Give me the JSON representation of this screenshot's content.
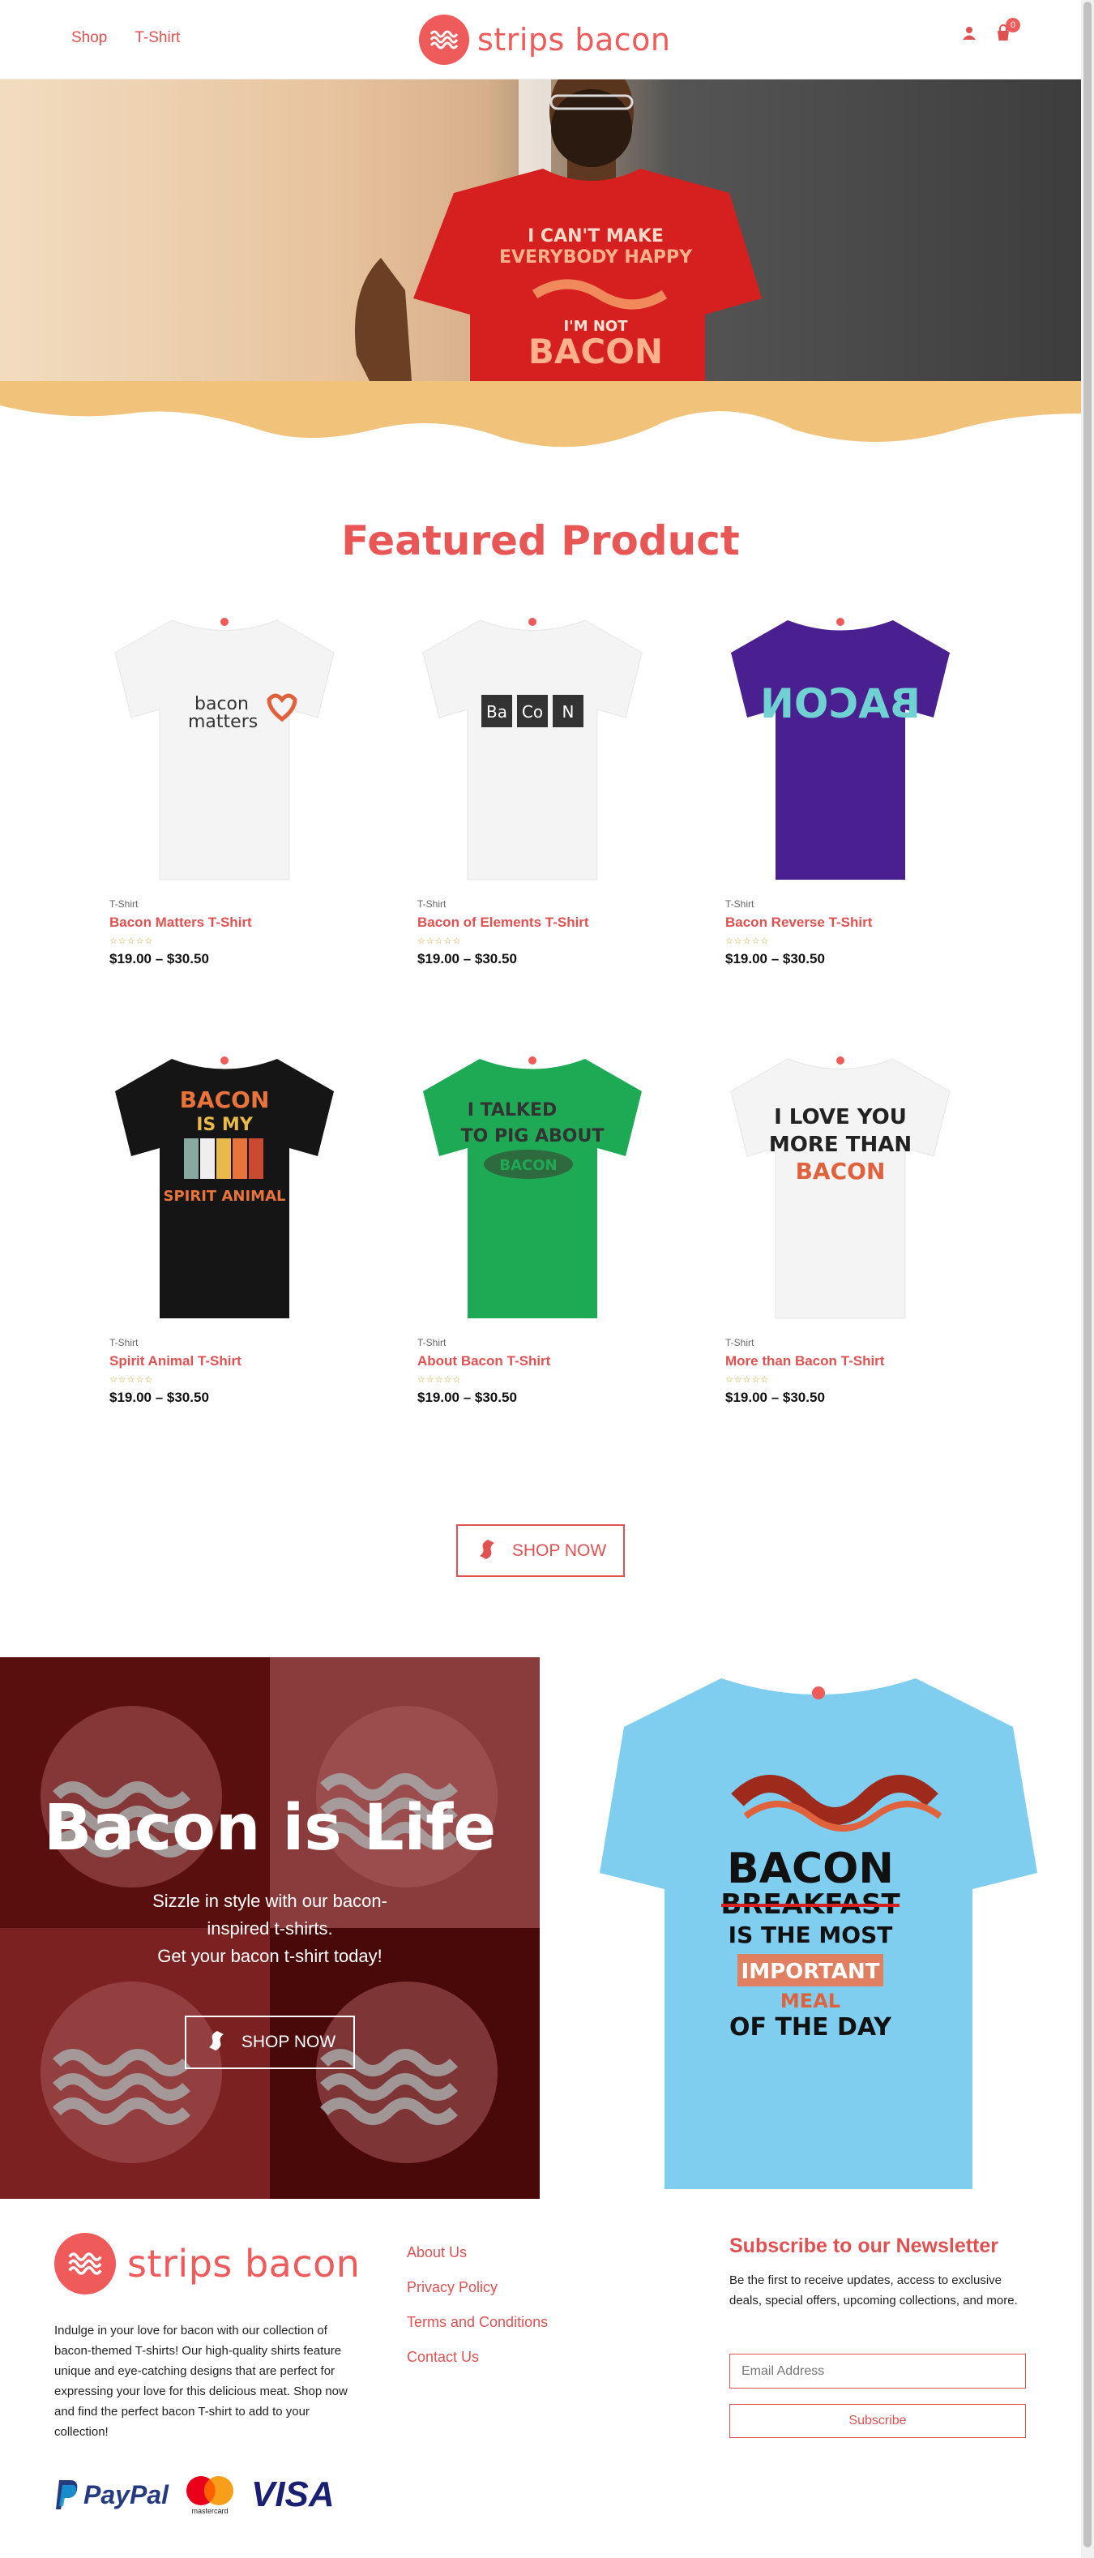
{
  "header": {
    "nav": [
      "Shop",
      "T-Shirt"
    ],
    "logo_text": "strips bacon",
    "cart_count": "0",
    "icons": [
      "user-icon",
      "cart-icon"
    ]
  },
  "hero": {
    "shirt_text": [
      "I CAN'T MAKE",
      "EVERYBODY HAPPY",
      "I'M NOT",
      "BACON"
    ]
  },
  "featured": {
    "title": "Featured Product",
    "products": [
      {
        "category": "T-Shirt",
        "name": "Bacon Matters T-Shirt",
        "price": "$19.00 – $30.50",
        "shirt_color": "#f4f4f4",
        "print": [
          "bacon",
          "matters"
        ]
      },
      {
        "category": "T-Shirt",
        "name": "Bacon of Elements T-Shirt",
        "price": "$19.00 – $30.50",
        "shirt_color": "#f4f4f4",
        "print": [
          "Ba",
          "Co",
          "N"
        ]
      },
      {
        "category": "T-Shirt",
        "name": "Bacon Reverse T-Shirt",
        "price": "$19.00 – $30.50",
        "shirt_color": "#4a1f8f",
        "print": [
          "BACON"
        ]
      },
      {
        "category": "T-Shirt",
        "name": "Spirit Animal T-Shirt",
        "price": "$19.00 – $30.50",
        "shirt_color": "#151515",
        "print": [
          "BACON",
          "IS MY",
          "SPIRIT ANIMAL"
        ]
      },
      {
        "category": "T-Shirt",
        "name": "About Bacon T-Shirt",
        "price": "$19.00 – $30.50",
        "shirt_color": "#1eaa55",
        "print": [
          "I TALKED",
          "TO PIG ABOUT",
          "BACON"
        ]
      },
      {
        "category": "T-Shirt",
        "name": "More than Bacon T-Shirt",
        "price": "$19.00 – $30.50",
        "shirt_color": "#f4f4f4",
        "print": [
          "I LOVE YOU",
          "MORE THAN",
          "BACON"
        ]
      }
    ],
    "shop_now": "SHOP NOW"
  },
  "promo": {
    "title": "Bacon is Life",
    "subtitle_line1": "Sizzle in style with our bacon-",
    "subtitle_line2": "inspired t-shirts.",
    "subtitle_line3": "Get your bacon t-shirt today!",
    "button": "SHOP NOW",
    "shirt_color": "#7fcdef",
    "shirt_text": [
      "BACON",
      "BREAKFAST",
      "IS THE MOST",
      "IMPORTANT",
      "MEAL",
      "OF THE DAY"
    ]
  },
  "footer": {
    "logo_text": "strips bacon",
    "description": "Indulge in your love for bacon with our collection of bacon-themed T-shirts! Our high-quality shirts feature unique and eye-catching designs that are perfect for expressing your love for this delicious meat. Shop now and find the perfect bacon T-shirt to add to your collection!",
    "links": [
      "About Us",
      "Privacy Policy",
      "Terms and Conditions",
      "Contact Us"
    ],
    "newsletter_title": "Subscribe to our Newsletter",
    "newsletter_desc": "Be the first to receive updates, access to exclusive deals, special offers, upcoming collections, and more.",
    "email_placeholder": "Email Address",
    "subscribe_label": "Subscribe",
    "payments": [
      "PayPal",
      "mastercard",
      "VISA"
    ]
  },
  "colors": {
    "accent": "#e95656",
    "wave": "#f0c27a",
    "promo_dark": "#5a0f0f"
  }
}
